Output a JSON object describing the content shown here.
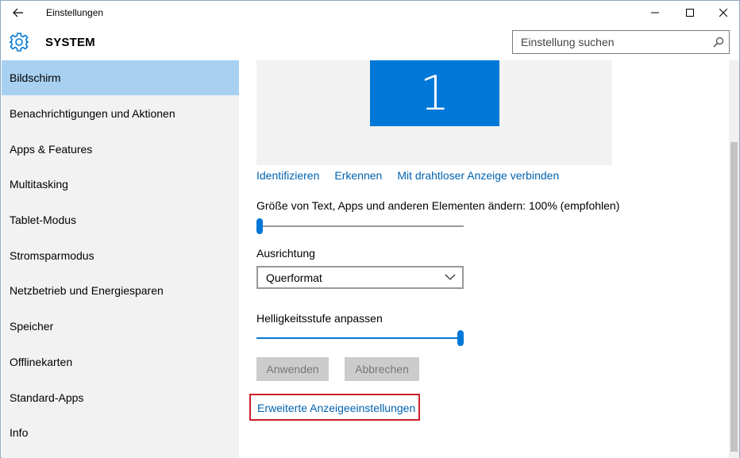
{
  "window": {
    "title": "Einstellungen"
  },
  "header": {
    "section_title": "SYSTEM",
    "search_placeholder": "Einstellung suchen"
  },
  "sidebar": {
    "items": [
      {
        "label": "Bildschirm",
        "selected": true
      },
      {
        "label": "Benachrichtigungen und Aktionen"
      },
      {
        "label": "Apps & Features"
      },
      {
        "label": "Multitasking"
      },
      {
        "label": "Tablet-Modus"
      },
      {
        "label": "Stromsparmodus"
      },
      {
        "label": "Netzbetrieb und Energiesparen"
      },
      {
        "label": "Speicher"
      },
      {
        "label": "Offlinekarten"
      },
      {
        "label": "Standard-Apps"
      },
      {
        "label": "Info"
      }
    ]
  },
  "display": {
    "monitor_number": "1",
    "links": {
      "identify": "Identifizieren",
      "detect": "Erkennen",
      "wireless": "Mit drahtloser Anzeige verbinden"
    },
    "scale_label": "Größe von Text, Apps und anderen Elementen ändern: 100% (empfohlen)",
    "scale_level": 0,
    "orientation_label": "Ausrichtung",
    "orientation_value": "Querformat",
    "brightness_label": "Helligkeitsstufe anpassen",
    "brightness_level": 1,
    "apply_label": "Anwenden",
    "cancel_label": "Abbrechen",
    "advanced_link": "Erweiterte Anzeigeeinstellungen"
  },
  "colors": {
    "accent": "#0078d7",
    "link": "#0063b1",
    "selected_nav": "#a8d0f0",
    "highlight_frame": "#cc1f2a"
  }
}
